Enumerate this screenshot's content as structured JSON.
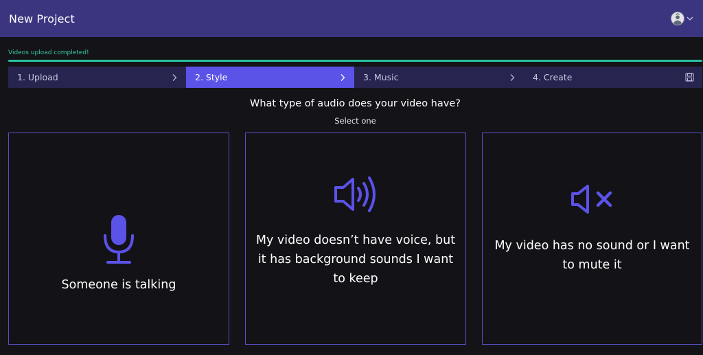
{
  "header": {
    "title": "New Project",
    "avatar_icon": "user-avatar-icon"
  },
  "upload": {
    "status_text": "Videos upload completed!",
    "progress": 1.0
  },
  "steps": [
    {
      "label": "1. Upload",
      "active": false
    },
    {
      "label": "2. Style",
      "active": true
    },
    {
      "label": "3. Music",
      "active": false
    },
    {
      "label": "4. Create",
      "active": false
    }
  ],
  "main": {
    "question": "What type of audio does your video have?",
    "subtitle": "Select one"
  },
  "options": [
    {
      "icon": "microphone-icon",
      "label": "Someone is talking"
    },
    {
      "icon": "speaker-volume-icon",
      "label": "My video doesn’t have voice, but it has background sounds I want to keep"
    },
    {
      "icon": "speaker-mute-icon",
      "label": "My video has no sound or I want to mute it"
    }
  ],
  "colors": {
    "header_bg": "#3b3580",
    "accent": "#5b52e8",
    "progress": "#29c3a1",
    "icon": "#5b52e8"
  }
}
